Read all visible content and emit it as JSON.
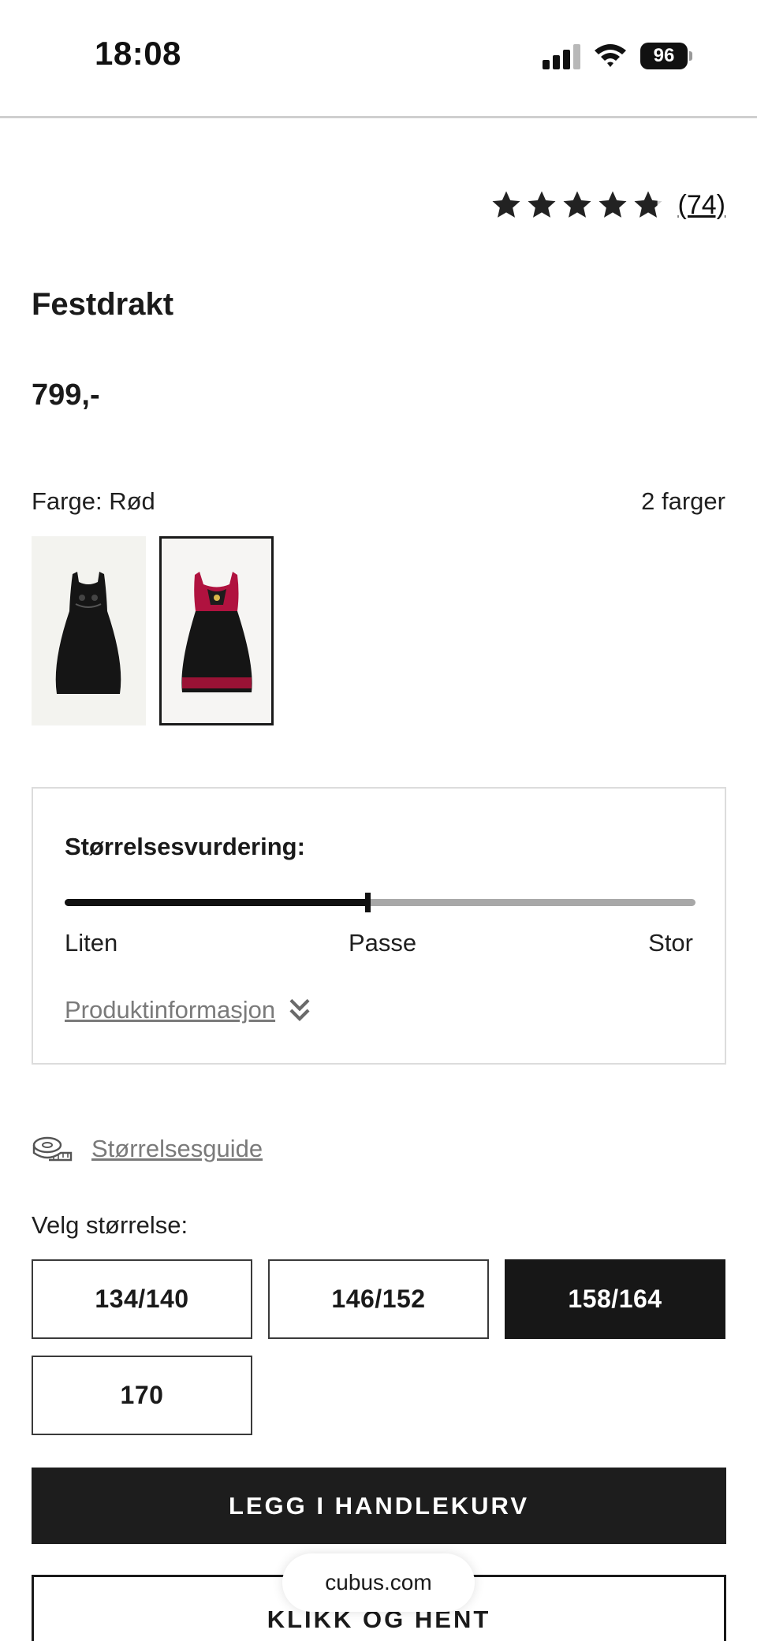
{
  "status_bar": {
    "time": "18:08",
    "battery": "96"
  },
  "rating": {
    "stars": 4.8,
    "count": "(74)"
  },
  "product": {
    "title": "Festdrakt",
    "price": "799,-",
    "color_label": "Farge: Rød",
    "color_count": "2 farger"
  },
  "fit": {
    "title": "Størrelsesvurdering:",
    "value_fraction": 0.48,
    "min_label": "Liten",
    "mid_label": "Passe",
    "max_label": "Stor",
    "product_info_link": "Produktinformasjon"
  },
  "size_guide_link": "Størrelsesguide",
  "choose_size_label": "Velg størrelse:",
  "sizes": [
    "134/140",
    "146/152",
    "158/164",
    "170"
  ],
  "selected_size": "158/164",
  "buttons": {
    "add_to_cart": "LEGG I HANDLEKURV",
    "click_collect": "KLIKK OG HENT"
  },
  "browser": {
    "url": "cubus.com"
  },
  "colors": {
    "accent_dark": "#1d1d1d",
    "dress_red": "#b0123f"
  }
}
